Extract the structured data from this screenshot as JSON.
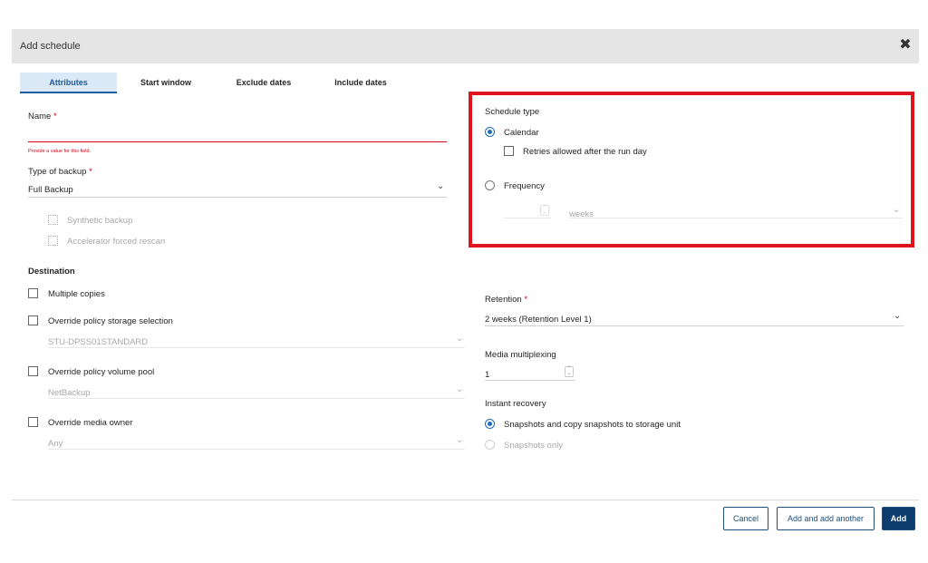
{
  "dialog": {
    "title": "Add schedule",
    "close_icon": "close-icon"
  },
  "tabs": [
    {
      "label": "Attributes",
      "active": true
    },
    {
      "label": "Start window",
      "active": false
    },
    {
      "label": "Exclude dates",
      "active": false
    },
    {
      "label": "Include dates",
      "active": false
    }
  ],
  "left": {
    "name_label": "Name",
    "required_mark": "*",
    "name_value": "",
    "name_error": "Provide a value for this field.",
    "backup_type_label": "Type of backup",
    "backup_type_value": "Full Backup",
    "synthetic_label": "Synthetic backup",
    "accelerator_label": "Accelerator forced rescan",
    "destination_heading": "Destination",
    "multiple_copies_label": "Multiple copies",
    "override_storage_label": "Override policy storage selection",
    "storage_value": "STU-DPSS01STANDARD",
    "override_pool_label": "Override policy volume pool",
    "pool_value": "NetBackup",
    "override_owner_label": "Override media owner",
    "owner_value": "Any"
  },
  "right": {
    "schedule_type_label": "Schedule type",
    "calendar_label": "Calendar",
    "retries_label": "Retries allowed after the run day",
    "frequency_label": "Frequency",
    "frequency_value": "",
    "frequency_unit": "weeks",
    "retention_label": "Retention",
    "retention_value": "2 weeks (Retention Level 1)",
    "multiplexing_label": "Media multiplexing",
    "multiplexing_value": "1",
    "instant_recovery_label": "Instant recovery",
    "ir_option1": "Snapshots and copy snapshots to storage unit",
    "ir_option2": "Snapshots only"
  },
  "footer": {
    "cancel_label": "Cancel",
    "add_another_label": "Add and add another",
    "add_label": "Add"
  },
  "colors": {
    "accent": "#1f6bb8",
    "error": "#d9001b",
    "highlight_box": "#e0141e",
    "primary_button": "#0c3b6e"
  }
}
